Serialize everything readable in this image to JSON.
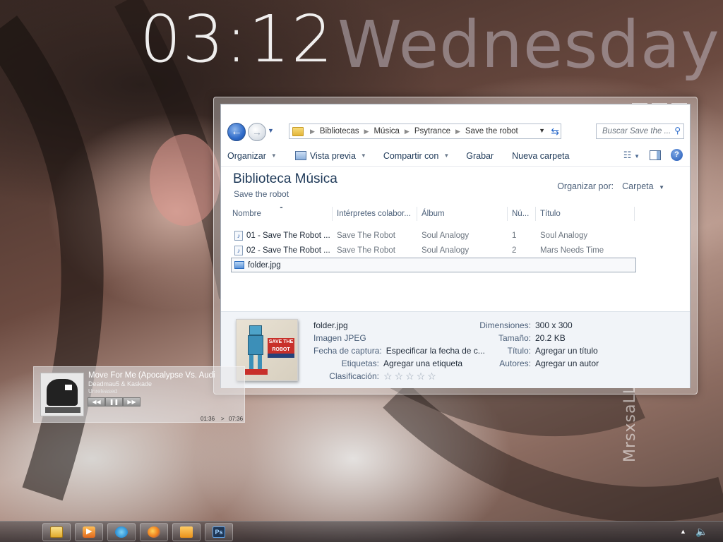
{
  "desktop": {
    "clock_time": "03:12",
    "clock_day": "Wednesday",
    "watermark": "MrsxsaLLy"
  },
  "explorer": {
    "breadcrumbs": [
      "Bibliotecas",
      "Música",
      "Psytrance",
      "Save the robot"
    ],
    "search_placeholder": "Buscar Save the ...",
    "toolbar": {
      "organize": "Organizar",
      "preview": "Vista previa",
      "share": "Compartir con",
      "burn": "Grabar",
      "new_folder": "Nueva carpeta"
    },
    "library_title": "Biblioteca Música",
    "library_subtitle": "Save the robot",
    "arrange_label": "Organizar por:",
    "arrange_value": "Carpeta",
    "columns": [
      "Nombre",
      "Intérpretes colabor...",
      "Álbum",
      "Nú...",
      "Título"
    ],
    "rows": [
      {
        "name": "01 - Save The Robot ...",
        "artist": "Save The Robot",
        "album": "Soul Analogy",
        "num": "1",
        "title": "Soul Analogy"
      },
      {
        "name": "02 - Save The Robot ...",
        "artist": "Save The Robot",
        "album": "Soul Analogy",
        "num": "2",
        "title": "Mars Needs Time"
      }
    ],
    "selected_file": "folder.jpg",
    "details": {
      "filename": "folder.jpg",
      "type": "Imagen JPEG",
      "capture_label": "Fecha de captura:",
      "capture_value": "Especificar la fecha de c...",
      "tags_label": "Etiquetas:",
      "tags_value": "Agregar una etiqueta",
      "rating_label": "Clasificación:",
      "dimensions_label": "Dimensiones:",
      "dimensions_value": "300 x 300",
      "size_label": "Tamaño:",
      "size_value": "20.2 KB",
      "title_label": "Título:",
      "title_value": "Agregar un título",
      "authors_label": "Autores:",
      "authors_value": "Agregar un autor"
    }
  },
  "media_player": {
    "track_title": "Move For Me (Apocalypse Vs. Audio",
    "artist": "Deadmau5 & Kaskade",
    "album": "Unreleased",
    "position": "01:36",
    "separator": ">",
    "duration": "07:36",
    "ps_label": "Ps"
  }
}
